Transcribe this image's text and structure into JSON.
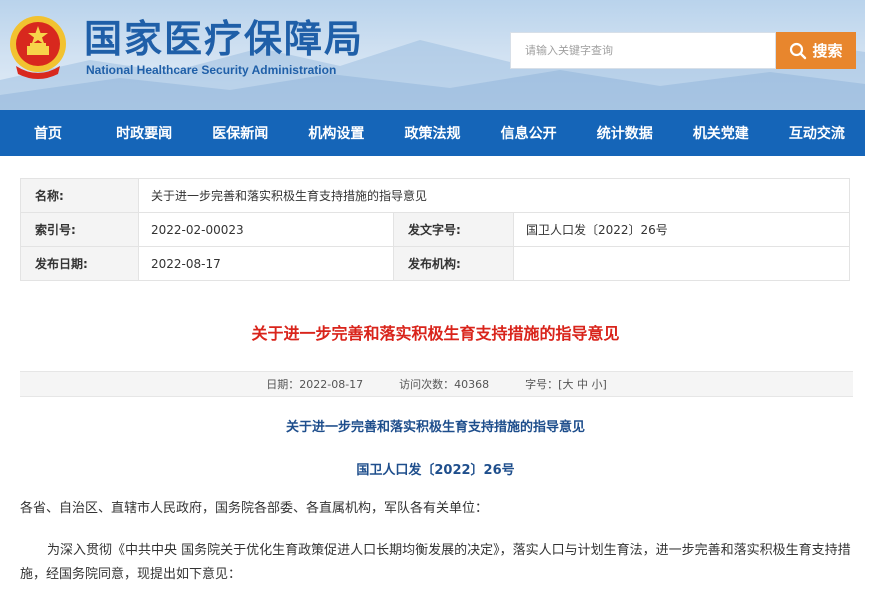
{
  "header": {
    "title_cn": "国家医疗保障局",
    "title_en": "National Healthcare Security Administration",
    "search_placeholder": "请输入关键字查询",
    "search_button": "搜索"
  },
  "nav": {
    "items": [
      "首页",
      "时政要闻",
      "医保新闻",
      "机构设置",
      "政策法规",
      "信息公开",
      "统计数据",
      "机关党建",
      "互动交流"
    ]
  },
  "meta": {
    "name_label": "名称:",
    "name_value": "关于进一步完善和落实积极生育支持措施的指导意见",
    "index_label": "索引号:",
    "index_value": "2022-02-00023",
    "docno_label": "发文字号:",
    "docno_value": "国卫人口发〔2022〕26号",
    "date_label": "发布日期:",
    "date_value": "2022-08-17",
    "org_label": "发布机构:",
    "org_value": ""
  },
  "article": {
    "title": "关于进一步完善和落实积极生育支持措施的指导意见",
    "info_date": "日期：2022-08-17",
    "info_visits": "访问次数：40368",
    "info_fontsize_label": "字号：[ ",
    "font_large": "大",
    "font_medium": "中",
    "font_small": "小",
    "info_fontsize_end": " ]",
    "sub_title": "关于进一步完善和落实积极生育支持措施的指导意见",
    "doc_no": "国卫人口发〔2022〕26号",
    "para1": "各省、自治区、直辖市人民政府，国务院各部委、各直属机构，军队各有关单位：",
    "para2": "为深入贯彻《中共中央 国务院关于优化生育政策促进人口长期均衡发展的决定》，落实人口与计划生育法，进一步完善和落实积极生育支持措施，经国务院同意，现提出如下意见："
  },
  "colors": {
    "nav_bg": "#1565b8",
    "title_red": "#d9241b",
    "search_orange": "#e8862d",
    "brand_blue": "#1f5fa8"
  }
}
